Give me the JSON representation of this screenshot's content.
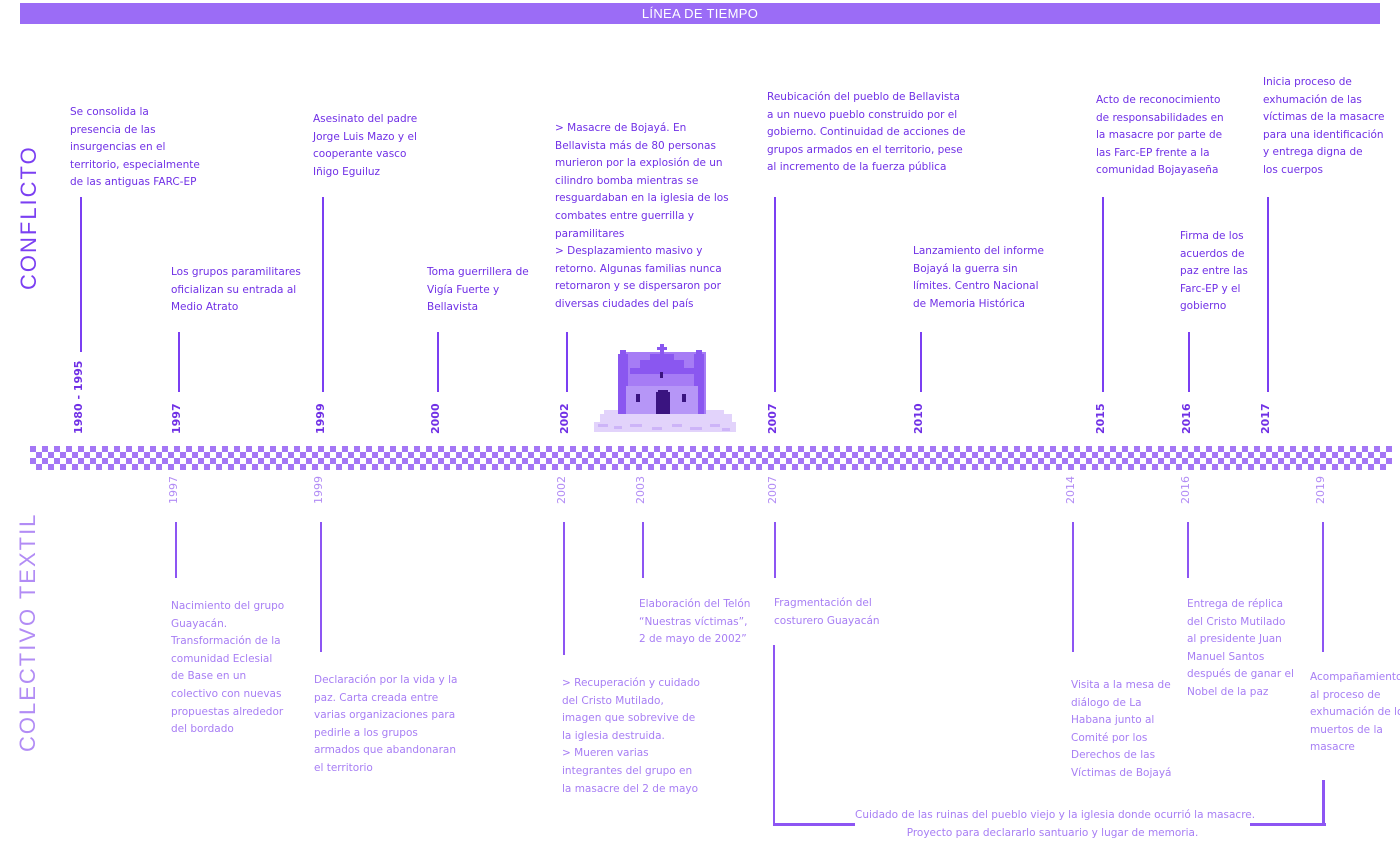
{
  "header": {
    "title": "LÍNEA DE TIEMPO"
  },
  "sections": {
    "conflict": "CONFLICTO",
    "textil": "COLECTIVO TEXTIL"
  },
  "colors": {
    "primary": "#7b3ff2",
    "header_bg": "#9b6cf6",
    "light": "#b28cf5",
    "checker": "#a476f5"
  },
  "conflict_events": [
    {
      "year": "1980 - 1995",
      "lines": [
        "Se consolida la",
        "presencia de las",
        "insurgencias en el",
        "territorio, especialmente",
        "de las antiguas FARC-EP"
      ]
    },
    {
      "year": "1997",
      "lines": [
        "Los grupos paramilitares",
        "oficializan su entrada al",
        "Medio Atrato"
      ]
    },
    {
      "year": "1999",
      "lines": [
        "Asesinato del padre",
        "Jorge Luis Mazo y el",
        "cooperante vasco",
        "Iñigo Eguiluz"
      ]
    },
    {
      "year": "2000",
      "lines": [
        "Toma guerrillera de",
        "Vigía Fuerte y",
        "Bellavista"
      ]
    },
    {
      "year": "2002",
      "lines": [
        "> Masacre de  Bojayá. En",
        "Bellavista más de 80 personas",
        "murieron por la explosión de un",
        "cilindro bomba mientras se",
        "resguardaban en la iglesia de los",
        "combates entre  guerrilla y",
        "paramilitares",
        "> Desplazamiento masivo y",
        "retorno. Algunas familias nunca",
        "retornaron y se dispersaron por",
        "diversas ciudades del país"
      ]
    },
    {
      "year": "2007",
      "lines": [
        "Reubicación del pueblo de Bellavista",
        "a un nuevo pueblo construido por el",
        "gobierno. Continuidad de acciones de",
        "grupos armados en el territorio, pese",
        "al incremento de la fuerza pública"
      ]
    },
    {
      "year": "2010",
      "lines": [
        "Lanzamiento del informe",
        "Bojayá la guerra sin",
        "límites. Centro Nacional",
        "de Memoria Histórica"
      ]
    },
    {
      "year": "2015",
      "lines": [
        "Acto de reconocimiento",
        "de responsabilidades en",
        "la masacre por parte de",
        "las Farc-EP frente a la",
        "comunidad Bojayaseña"
      ]
    },
    {
      "year": "2016",
      "lines": [
        "Firma de los",
        "acuerdos de",
        "paz entre las",
        "Farc-EP y el",
        "gobierno"
      ]
    },
    {
      "year": "2017",
      "lines": [
        "Inicia proceso de",
        "exhumación de las",
        "víctimas de la masacre",
        "para una identificación",
        "y entrega digna de",
        "los cuerpos"
      ]
    }
  ],
  "textil_events": [
    {
      "year": "1997",
      "lines": [
        "Nacimiento del grupo",
        "Guayacán.",
        "Transformación de la",
        "comunidad Eclesial",
        "de Base en un",
        "colectivo con nuevas",
        "propuestas alrededor",
        "del bordado"
      ]
    },
    {
      "year": "1999",
      "lines": [
        "Declaración por la vida y la",
        "paz. Carta creada entre",
        "varias organizaciones para",
        "pedirle a los grupos",
        "armados que abandonaran",
        "el territorio"
      ]
    },
    {
      "year": "2002",
      "lines": [
        "> Recuperación y cuidado",
        "del Cristo Mutilado,",
        "imagen que sobrevive de",
        "la iglesia destruida.",
        "> Mueren varias",
        "integrantes del grupo en",
        "la masacre del 2 de mayo"
      ]
    },
    {
      "year": "2003",
      "lines": [
        "Elaboración del Telón",
        "“Nuestras víctimas”,",
        "2 de mayo de 2002”"
      ]
    },
    {
      "year": "2007",
      "lines": [
        "Fragmentación del",
        "costurero Guayacán"
      ]
    },
    {
      "year": "2014",
      "lines": [
        "Visita a la mesa de",
        "diálogo de La",
        "Habana junto al",
        "Comité por los",
        "Derechos de las",
        "Víctimas de Bojayá"
      ]
    },
    {
      "year": "2016",
      "lines": [
        "Entrega de réplica",
        "del Cristo Mutilado",
        "al presidente Juan",
        "Manuel Santos",
        "después de ganar el",
        "Nobel de la paz"
      ]
    },
    {
      "year": "2019",
      "lines": [
        "Acompañamiento",
        "al proceso de",
        "exhumación de los",
        "muertos de la",
        "masacre"
      ]
    }
  ],
  "bracket_note": {
    "lines": [
      "Cuidado de las ruinas del pueblo viejo y la iglesia donde ocurrió la masacre.",
      "Proyecto para declararlo santuario y lugar de memoria."
    ]
  }
}
